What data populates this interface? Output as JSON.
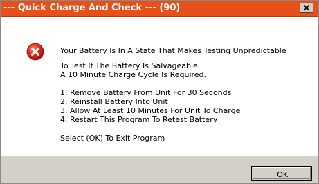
{
  "window": {
    "title": "--- Quick Charge And Check --- (90)",
    "close_glyph": "×",
    "accent_color": "#e8501a"
  },
  "dialog": {
    "icon": "error-icon",
    "headline": "Your Battery Is In A State That Makes Testing Unpredictable",
    "para1_line1": "To Test If The Battery Is Salvageable",
    "para1_line2": "A 10 Minute Charge Cycle Is Required.",
    "steps": [
      "1. Remove Battery From Unit For 30 Seconds",
      "2. Reinstall Battery Into Unit",
      "3. Allow At Least 10 Minutes For Unit To Charge",
      "4. Restart This Program To Retest Battery"
    ],
    "exit_note": "Select (OK) To Exit Program"
  },
  "buttons": {
    "ok_label": "OK"
  }
}
